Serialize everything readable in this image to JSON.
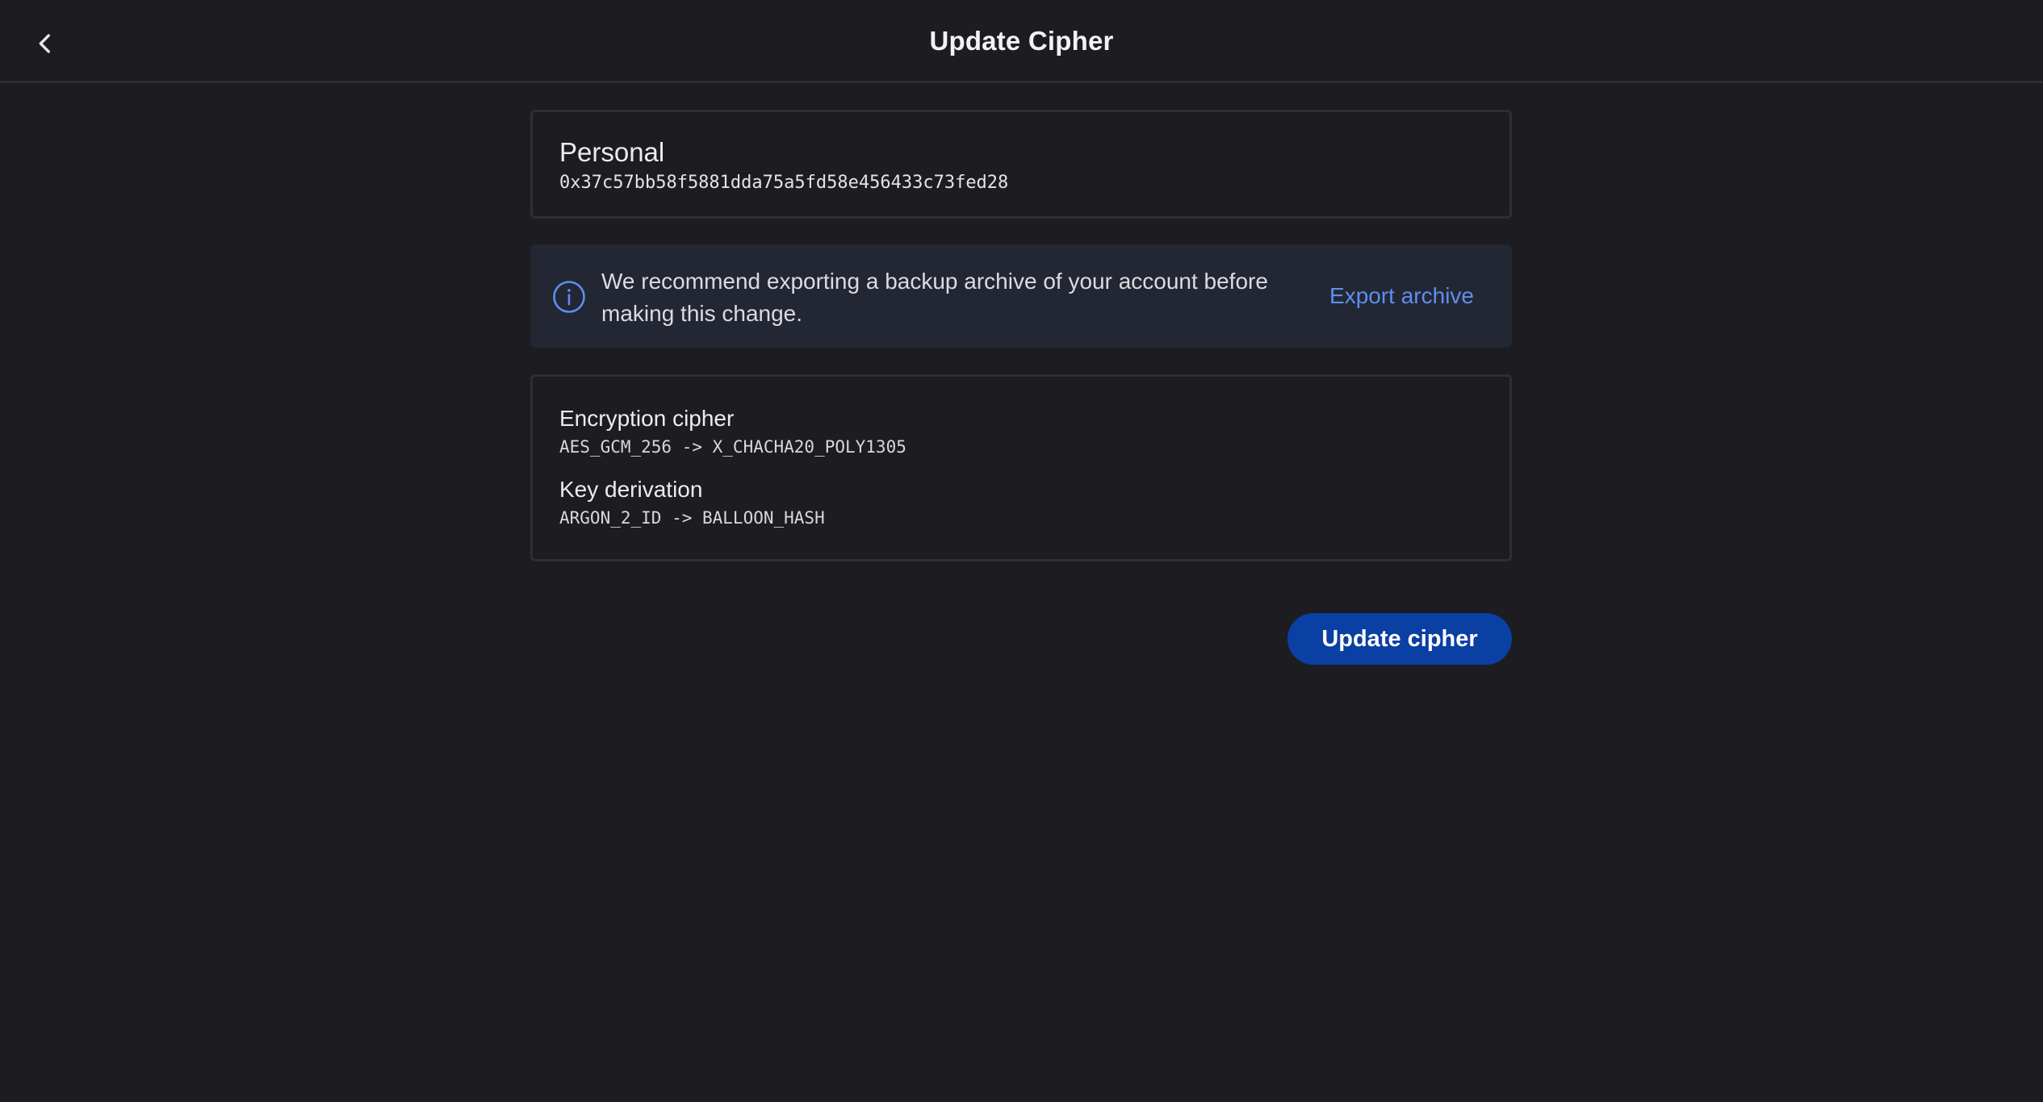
{
  "header": {
    "title": "Update Cipher",
    "back_icon": "chevron-left-icon"
  },
  "account": {
    "name": "Personal",
    "address": "0x37c57bb58f5881dda75a5fd58e456433c73fed28"
  },
  "notice": {
    "icon": "info-icon",
    "message": "We recommend exporting a backup archive of your account before making this change.",
    "action_label": "Export archive",
    "accent_color": "#5f8ef0"
  },
  "cipher": {
    "encryption_label": "Encryption cipher",
    "encryption_value": "AES_GCM_256 -> X_CHACHA20_POLY1305",
    "kdf_label": "Key derivation",
    "kdf_value": "ARGON_2_ID -> BALLOON_HASH"
  },
  "actions": {
    "update_label": "Update cipher",
    "button_color": "#0a3fa3"
  }
}
